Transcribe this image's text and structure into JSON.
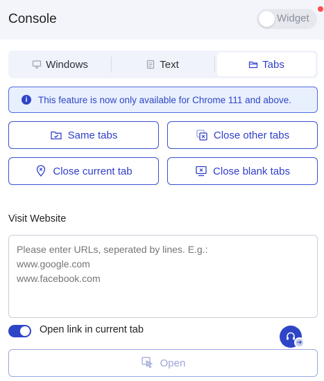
{
  "header": {
    "title": "Console",
    "widget_label": "Widget"
  },
  "tabs": [
    {
      "label": "Windows",
      "icon": "monitor-icon",
      "active": false
    },
    {
      "label": "Text",
      "icon": "document-icon",
      "active": false
    },
    {
      "label": "Tabs",
      "icon": "folder-icon",
      "active": true
    }
  ],
  "notice": {
    "text": "This feature is now only available for Chrome 111 and above."
  },
  "actions": {
    "same_tabs": "Same tabs",
    "close_other_tabs": "Close other tabs",
    "close_current_tab": "Close current tab",
    "close_blank_tabs": "Close blank tabs"
  },
  "visit": {
    "label": "Visit Website",
    "placeholder": "Please enter URLs, seperated by lines. E.g.:\nwww.google.com\nwww.facebook.com",
    "open_current_label": "Open link in current tab",
    "open_current_enabled": true,
    "open_button": "Open"
  },
  "colors": {
    "accent": "#2f45c7",
    "header_bg": "#f3f5fb",
    "notice_bg": "#e9f0fd",
    "badge_red": "#ff4d4f"
  }
}
